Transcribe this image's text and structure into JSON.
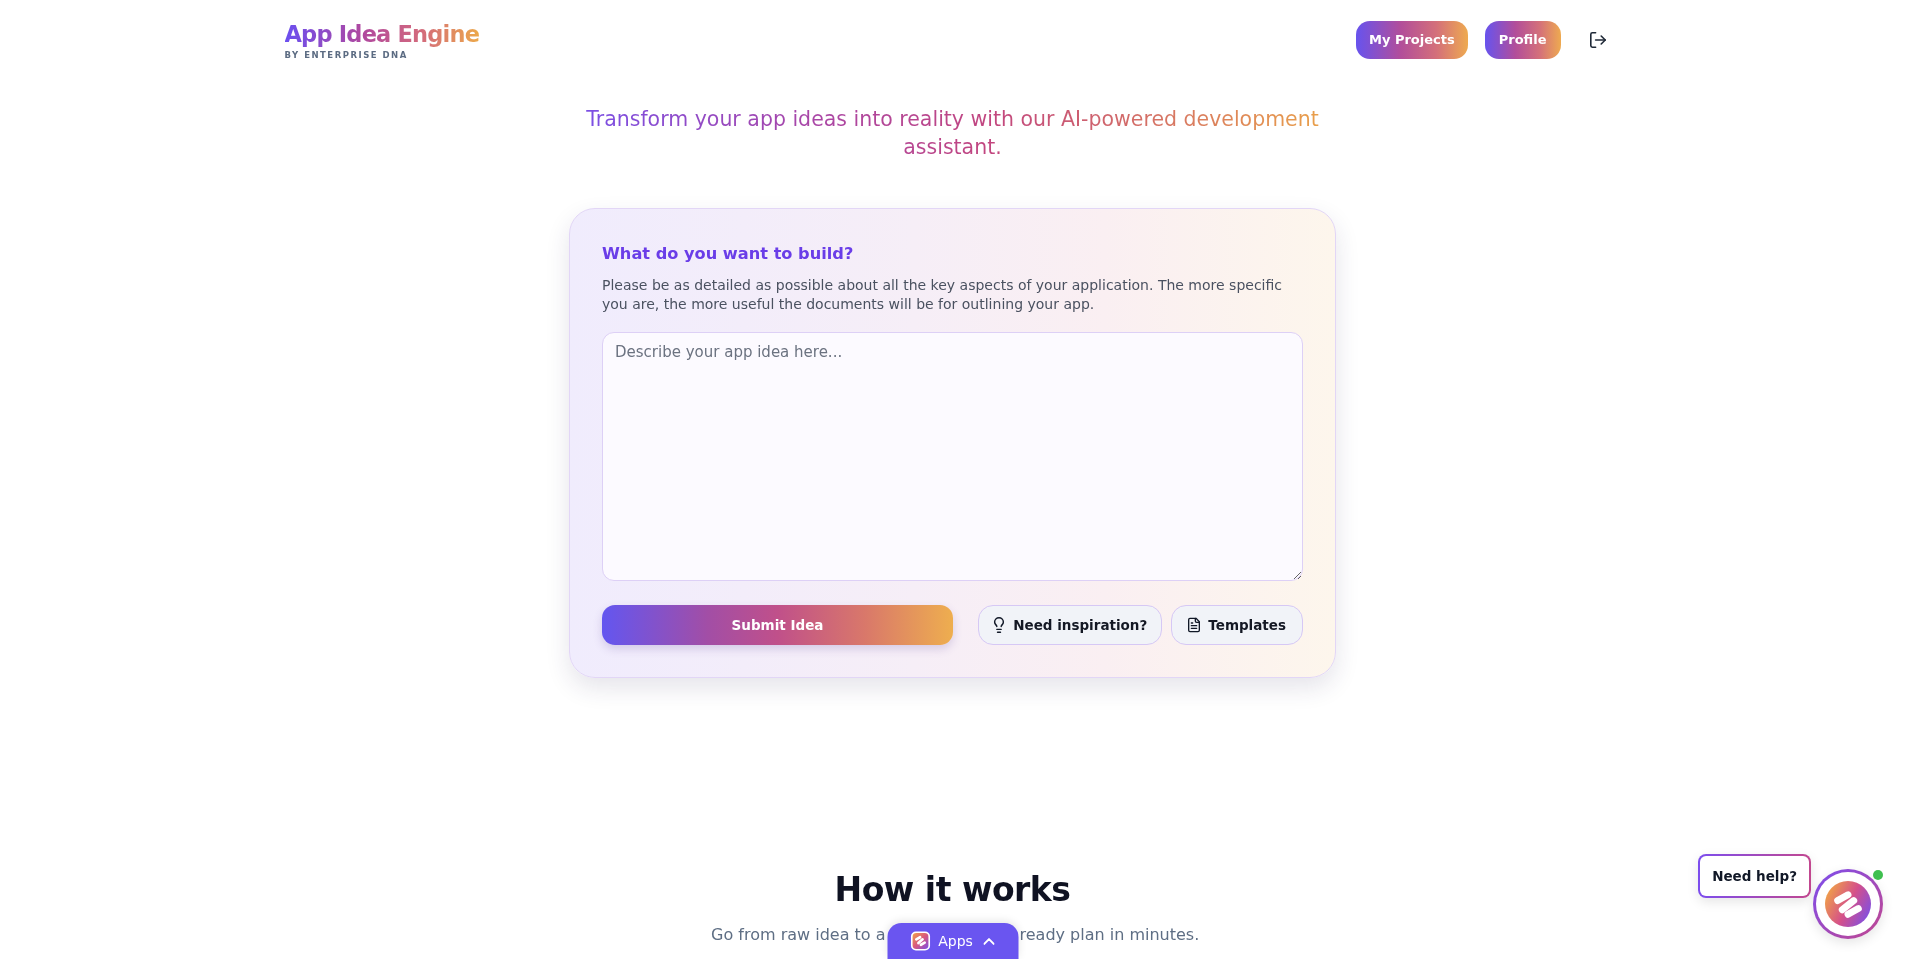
{
  "header": {
    "logo": {
      "title": "App Idea Engine",
      "subtitle": "BY ENTERPRISE DNA"
    },
    "nav_buttons": [
      {
        "label": "My Projects"
      },
      {
        "label": "Profile"
      }
    ]
  },
  "tagline": "Transform your app ideas into reality with our AI-powered development assistant.",
  "idea_form": {
    "heading": "What do you want to build?",
    "description": "Please be as detailed as possible about all the key aspects of your application. The more specific you are, the more useful the documents will be for outlining your app.",
    "idea_field": {
      "placeholder": "Describe your app idea here..."
    },
    "submit_button": "Submit Idea",
    "secondary_buttons": [
      {
        "label": "Need inspiration?",
        "kind": "inspiration"
      },
      {
        "label": "Templates",
        "kind": "templates"
      }
    ]
  },
  "how_it_works": {
    "title": "How it works",
    "subtitle_visible_parts": [
      "Go from raw idea to a",
      "ready plan in minutes."
    ]
  },
  "apps_tab": {
    "label": "Apps"
  },
  "help_widget": {
    "label": "Need help?",
    "online": true
  }
}
